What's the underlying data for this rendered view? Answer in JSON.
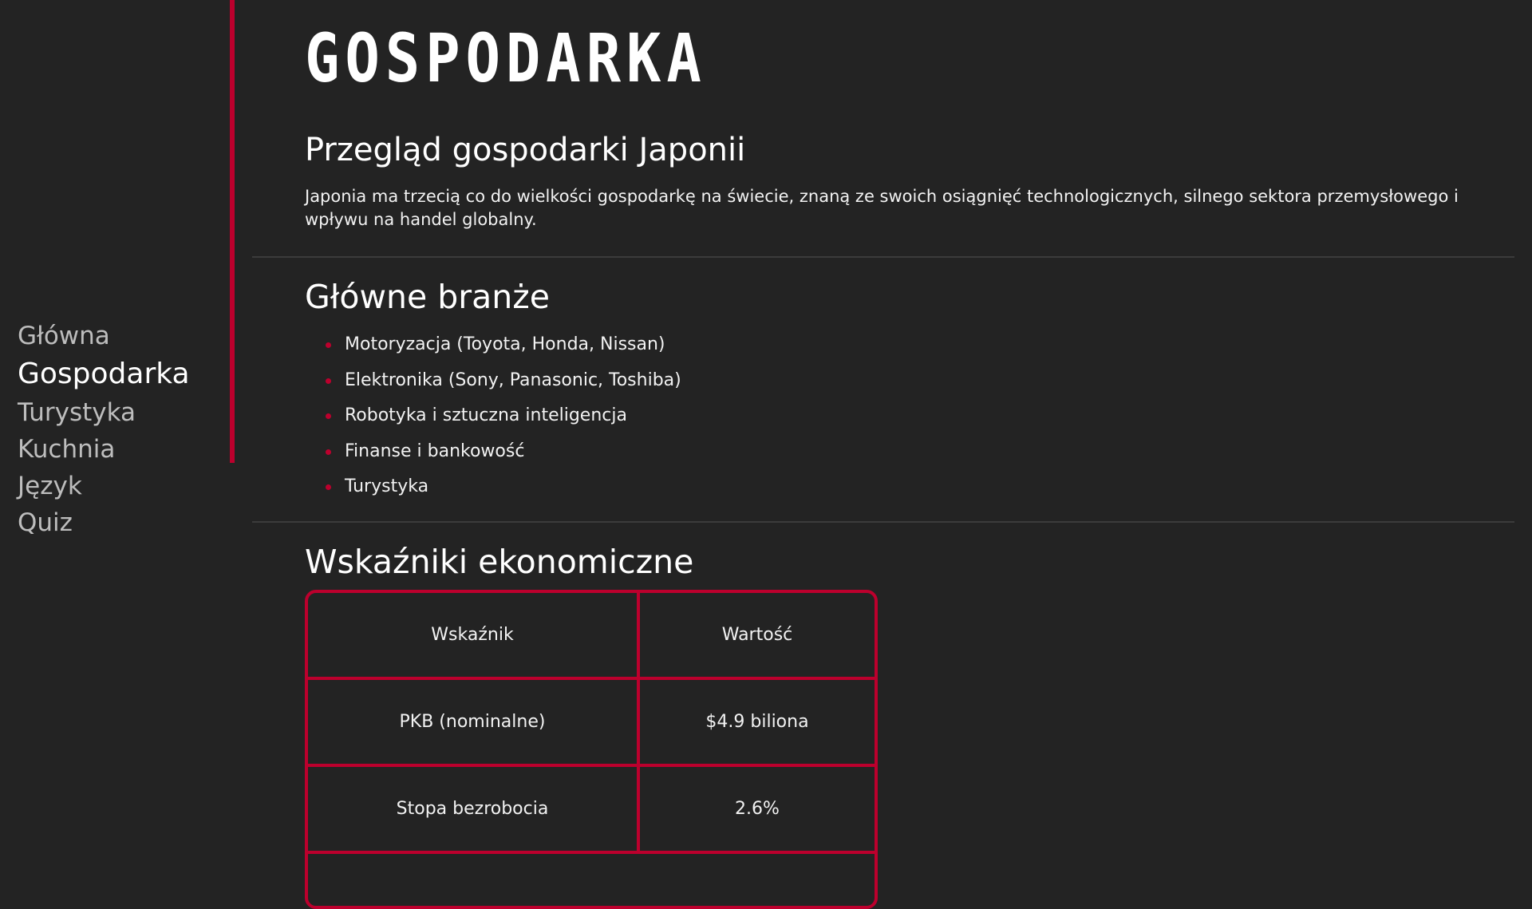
{
  "sidebar": {
    "items": [
      {
        "label": "Główna"
      },
      {
        "label": "Gospodarka"
      },
      {
        "label": "Turystyka"
      },
      {
        "label": "Kuchnia"
      },
      {
        "label": "Język"
      },
      {
        "label": "Quiz"
      }
    ],
    "active_item": "Gospodarka",
    "accent_color": "#bc002d"
  },
  "page": {
    "logo_text": "GOSPODARKA",
    "overview": {
      "title": "Przegląd gospodarki Japonii",
      "text": "Japonia ma trzecią co do wielkości gospodarkę na świecie, znaną ze swoich osiągnięć technologicznych, silnego sektora przemysłowego i wpływu na handel globalny."
    },
    "industries": {
      "title": "Główne branże",
      "items": [
        "Motoryzacja (Toyota, Honda, Nissan)",
        "Elektronika (Sony, Panasonic, Toshiba)",
        "Robotyka i sztuczna inteligencja",
        "Finanse i bankowość",
        "Turystyka"
      ]
    },
    "indicators": {
      "title": "Wskaźniki ekonomiczne",
      "headers": [
        "Wskaźnik",
        "Wartość"
      ],
      "rows": [
        [
          "PKB (nominalne)",
          "$4.9 biliona"
        ],
        [
          "Stopa bezrobocia",
          "2.6%"
        ]
      ]
    }
  },
  "colors": {
    "background": "#232323",
    "accent": "#bc002d",
    "text": "#f2f2f2",
    "nav_inactive": "#bdbdbd"
  }
}
